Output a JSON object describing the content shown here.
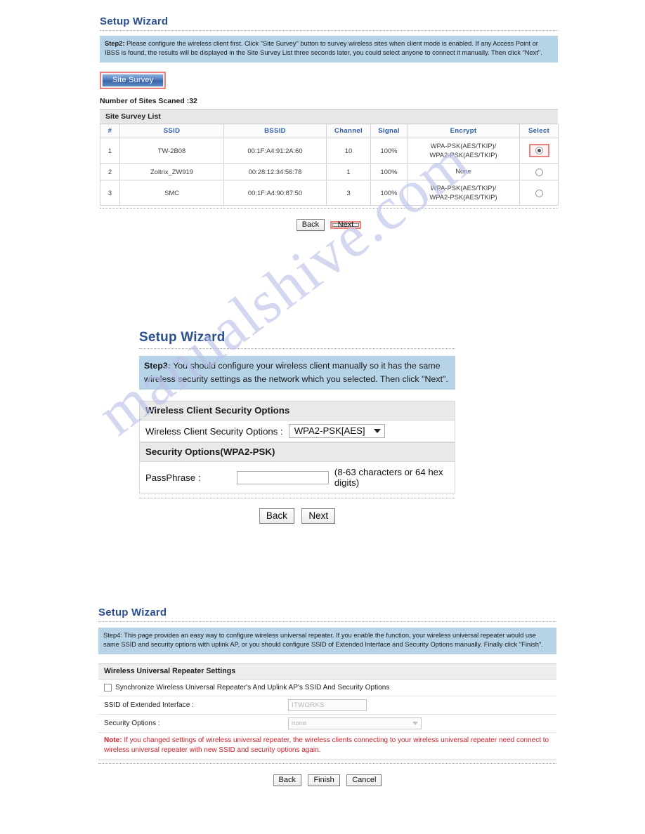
{
  "watermark": "manualshive.com",
  "step2": {
    "title": "Setup Wizard",
    "banner_label": "Step2:",
    "banner_text": " Please configure the wireless client first. Click \"Site Survey\" button to survey wireless sites when client mode is enabled. If any Access Point or IBSS is found, the results will be displayed in the Site Survey List three seconds later, you could select anyone to connect it manually. Then click \"Next\".",
    "site_survey_button": "Site Survey",
    "scan_count_label": "Number of Sites Scaned :32",
    "list_title": "Site Survey List",
    "columns": [
      "#",
      "SSID",
      "BSSID",
      "Channel",
      "Signal",
      "Encrypt",
      "Select"
    ],
    "rows": [
      {
        "index": "1",
        "ssid": "TW-2B08",
        "bssid": "00:1F:A4:91:2A:60",
        "channel": "10",
        "signal": "100%",
        "encrypt_line1": "WPA-PSK(AES/TKIP)/",
        "encrypt_line2": "WPA2-PSK(AES/TKIP)",
        "selected": true
      },
      {
        "index": "2",
        "ssid": "Zoltrix_ZW919",
        "bssid": "00:28:12:34:56:78",
        "channel": "1",
        "signal": "100%",
        "encrypt_line1": "None",
        "encrypt_line2": "",
        "selected": false
      },
      {
        "index": "3",
        "ssid": "SMC",
        "bssid": "00:1F:A4:90:87:50",
        "channel": "3",
        "signal": "100%",
        "encrypt_line1": "WPA-PSK(AES/TKIP)/",
        "encrypt_line2": "WPA2-PSK(AES/TKIP)",
        "selected": false
      }
    ],
    "back_button": "Back",
    "next_button": "Next"
  },
  "step3": {
    "title": "Setup Wizard",
    "banner_label": "Step3:",
    "banner_text": " You should configure your wireless client manually so it has the same wireless security settings as the network which you selected. Then click \"Next\".",
    "section_header": "Wireless Client Security Options",
    "security_label": "Wireless Client Security Options :",
    "security_value": "WPA2-PSK[AES]",
    "security_section_header": "Security Options(WPA2-PSK)",
    "passphrase_label": "PassPhrase :",
    "passphrase_value": "",
    "passphrase_hint": "(8-63 characters or 64 hex digits)",
    "back_button": "Back",
    "next_button": "Next"
  },
  "step4": {
    "title": "Setup Wizard",
    "banner_label": "Step4:",
    "banner_text": " This page provides an easy way to configure wireless universal repeater. If you enable the function, your wireless universal repeater would use same SSID and security options with uplink AP, or you should configure SSID of Extended Interface and Security Options manually. Finally click \"Finish\".",
    "section_header": "Wireless Universal Repeater Settings",
    "sync_checkbox_label": "Synchronize Wireless Universal Repeater's And Uplink AP's SSID And Security Options",
    "sync_checked": false,
    "ssid_label": "SSID of Extended Interface :",
    "ssid_value": "ITWORKS",
    "security_label": "Security Options :",
    "security_value": "none",
    "note_label": "Note:",
    "note_text": " If you changed settings of wireless universal repeater, the wireless clients connecting to your wireless universal repeater need connect to wireless universal repeater with new SSID and security options again.",
    "back_button": "Back",
    "finish_button": "Finish",
    "cancel_button": "Cancel"
  }
}
